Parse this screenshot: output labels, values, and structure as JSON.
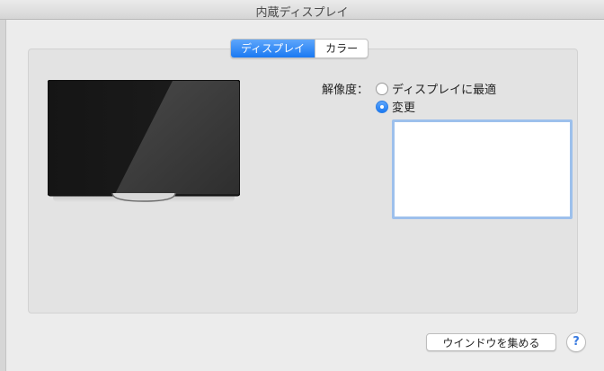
{
  "window": {
    "title": "内蔵ディスプレイ"
  },
  "tabs": [
    {
      "label": "ディスプレイ",
      "selected": true
    },
    {
      "label": "カラー",
      "selected": false
    }
  ],
  "resolution": {
    "label": "解像度：",
    "options": [
      {
        "label": "ディスプレイに最適",
        "selected": false
      },
      {
        "label": "変更",
        "selected": true
      }
    ]
  },
  "footer": {
    "gather_windows_label": "ウインドウを集める",
    "help_label": "?"
  },
  "colors": {
    "accent": "#1a79f2",
    "focus_ring": "#9dc0ec"
  },
  "icons": {
    "display_preview": "display-icon",
    "help": "help-icon"
  }
}
